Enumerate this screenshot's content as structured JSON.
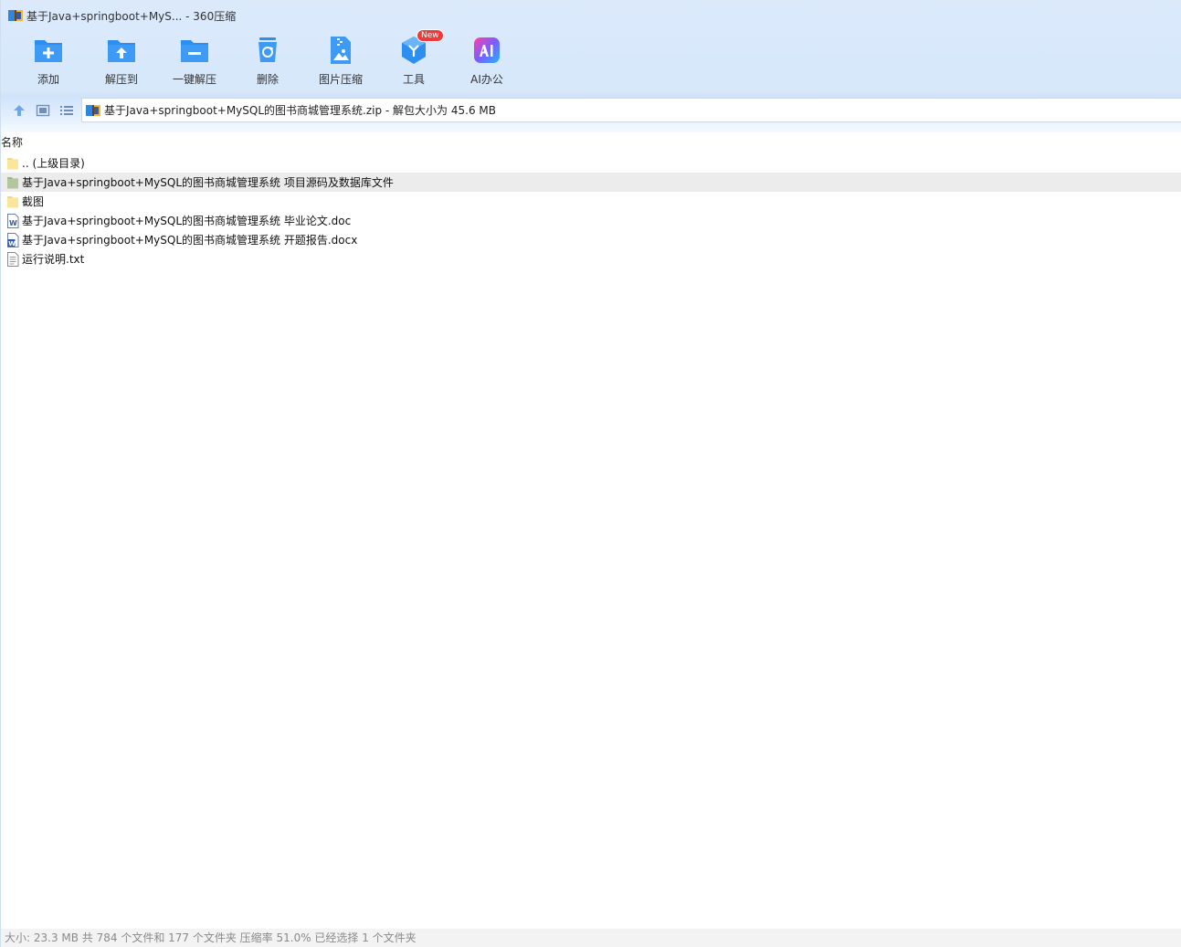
{
  "window": {
    "title": "基于Java+springboot+MyS... - 360压缩"
  },
  "toolbar": {
    "items": [
      {
        "label": "添加",
        "icon": "add-folder-icon"
      },
      {
        "label": "解压到",
        "icon": "extract-to-icon"
      },
      {
        "label": "一键解压",
        "icon": "one-click-extract-icon"
      },
      {
        "label": "删除",
        "icon": "delete-bin-icon"
      },
      {
        "label": "图片压缩",
        "icon": "image-compress-icon"
      },
      {
        "label": "工具",
        "icon": "tools-cube-icon",
        "badge": "New"
      },
      {
        "label": "AI办公",
        "icon": "ai-office-icon"
      }
    ]
  },
  "nav": {
    "path": "基于Java+springboot+MySQL的图书商城管理系统.zip - 解包大小为 45.6 MB"
  },
  "list": {
    "column_name": "名称",
    "rows": [
      {
        "name": ".. (上级目录)",
        "type": "folder",
        "selected": false
      },
      {
        "name": "基于Java+springboot+MySQL的图书商城管理系统 项目源码及数据库文件",
        "type": "folder",
        "selected": true
      },
      {
        "name": "截图",
        "type": "folder",
        "selected": false
      },
      {
        "name": "基于Java+springboot+MySQL的图书商城管理系统 毕业论文.doc",
        "type": "doc",
        "selected": false
      },
      {
        "name": "基于Java+springboot+MySQL的图书商城管理系统 开题报告.docx",
        "type": "docx",
        "selected": false
      },
      {
        "name": "运行说明.txt",
        "type": "txt",
        "selected": false
      }
    ]
  },
  "status": {
    "text": "大小: 23.3 MB 共 784 个文件和 177 个文件夹 压缩率 51.0% 已经选择 1 个文件夹"
  },
  "colors": {
    "accent": "#2f8ff0",
    "header_bg": "#d7e8fb",
    "selected_row": "#ececec",
    "badge": "#f03a3a"
  }
}
